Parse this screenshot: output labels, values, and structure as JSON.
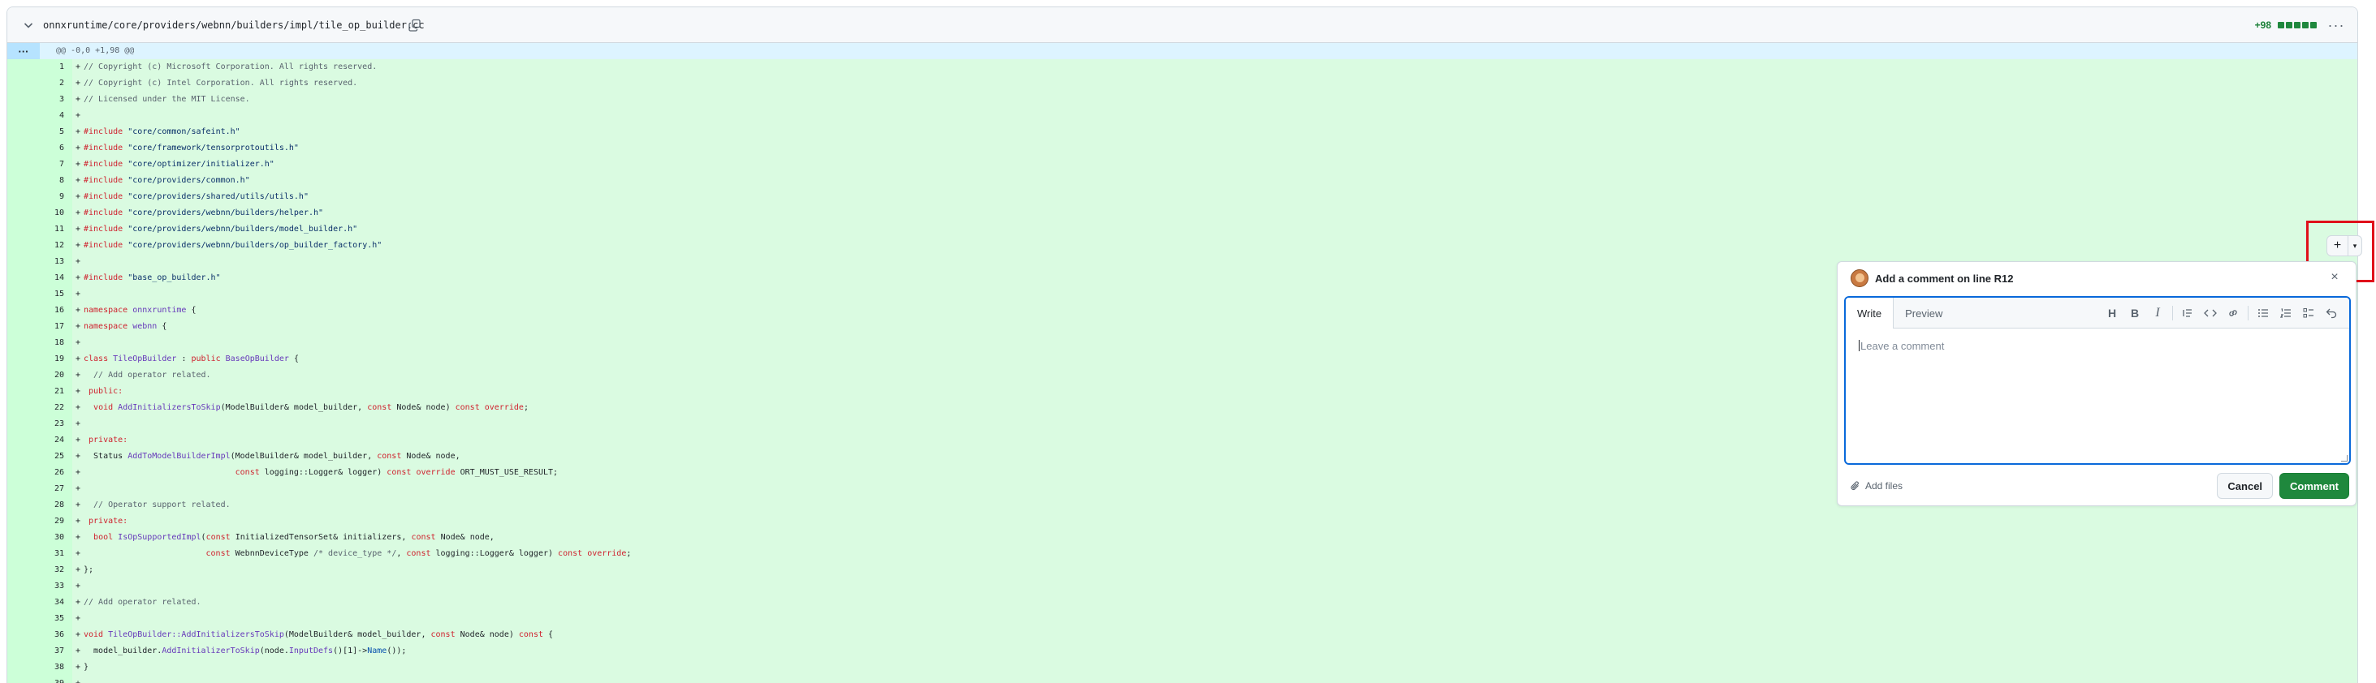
{
  "file": {
    "path": "onnxruntime/core/providers/webnn/builders/impl/tile_op_builder.cc",
    "additions": "+98",
    "diff_blocks": 5,
    "hunk_header": "@@ -0,0 +1,98 @@",
    "expand_label": "···",
    "menu_label": "···",
    "icons": [
      "chevron-down-icon",
      "copy-icon",
      "kebab-horizontal-icon"
    ]
  },
  "diff": {
    "lines": [
      {
        "n": "1",
        "s": "+",
        "t": [
          [
            "cm",
            "// Copyright (c) Microsoft Corporation. All rights reserved."
          ]
        ]
      },
      {
        "n": "2",
        "s": "+",
        "t": [
          [
            "cm",
            "// Copyright (c) Intel Corporation. All rights reserved."
          ]
        ]
      },
      {
        "n": "3",
        "s": "+",
        "t": [
          [
            "cm",
            "// Licensed under the MIT License."
          ]
        ]
      },
      {
        "n": "4",
        "s": "+",
        "t": []
      },
      {
        "n": "5",
        "s": "+",
        "t": [
          [
            "kw",
            "#include"
          ],
          [
            "",
            " "
          ],
          [
            "str",
            "\"core/common/safeint.h\""
          ]
        ]
      },
      {
        "n": "6",
        "s": "+",
        "t": [
          [
            "kw",
            "#include"
          ],
          [
            "",
            " "
          ],
          [
            "str",
            "\"core/framework/tensorprotoutils.h\""
          ]
        ]
      },
      {
        "n": "7",
        "s": "+",
        "t": [
          [
            "kw",
            "#include"
          ],
          [
            "",
            " "
          ],
          [
            "str",
            "\"core/optimizer/initializer.h\""
          ]
        ]
      },
      {
        "n": "8",
        "s": "+",
        "t": [
          [
            "kw",
            "#include"
          ],
          [
            "",
            " "
          ],
          [
            "str",
            "\"core/providers/common.h\""
          ]
        ]
      },
      {
        "n": "9",
        "s": "+",
        "t": [
          [
            "kw",
            "#include"
          ],
          [
            "",
            " "
          ],
          [
            "str",
            "\"core/providers/shared/utils/utils.h\""
          ]
        ]
      },
      {
        "n": "10",
        "s": "+",
        "t": [
          [
            "kw",
            "#include"
          ],
          [
            "",
            " "
          ],
          [
            "str",
            "\"core/providers/webnn/builders/helper.h\""
          ]
        ]
      },
      {
        "n": "11",
        "s": "+",
        "t": [
          [
            "kw",
            "#include"
          ],
          [
            "",
            " "
          ],
          [
            "str",
            "\"core/providers/webnn/builders/model_builder.h\""
          ]
        ]
      },
      {
        "n": "12",
        "s": "+",
        "t": [
          [
            "kw",
            "#include"
          ],
          [
            "",
            " "
          ],
          [
            "str",
            "\"core/providers/webnn/builders/op_builder_factory.h\""
          ]
        ]
      },
      {
        "n": "13",
        "s": "+",
        "t": []
      },
      {
        "n": "14",
        "s": "+",
        "t": [
          [
            "kw",
            "#include"
          ],
          [
            "",
            " "
          ],
          [
            "str",
            "\"base_op_builder.h\""
          ]
        ]
      },
      {
        "n": "15",
        "s": "+",
        "t": []
      },
      {
        "n": "16",
        "s": "+",
        "t": [
          [
            "kw",
            "namespace"
          ],
          [
            "",
            " "
          ],
          [
            "fn",
            "onnxruntime"
          ],
          [
            "",
            " {"
          ]
        ]
      },
      {
        "n": "17",
        "s": "+",
        "t": [
          [
            "kw",
            "namespace"
          ],
          [
            "",
            " "
          ],
          [
            "fn",
            "webnn"
          ],
          [
            "",
            " {"
          ]
        ]
      },
      {
        "n": "18",
        "s": "+",
        "t": []
      },
      {
        "n": "19",
        "s": "+",
        "t": [
          [
            "kw",
            "class"
          ],
          [
            "",
            " "
          ],
          [
            "fn",
            "TileOpBuilder"
          ],
          [
            "",
            " : "
          ],
          [
            "kw",
            "public"
          ],
          [
            "",
            " "
          ],
          [
            "fn",
            "BaseOpBuilder"
          ],
          [
            "",
            " {"
          ]
        ]
      },
      {
        "n": "20",
        "s": "+",
        "t": [
          [
            "cm",
            "  // Add operator related."
          ]
        ]
      },
      {
        "n": "21",
        "s": "+",
        "t": [
          [
            "kw",
            " public:"
          ]
        ]
      },
      {
        "n": "22",
        "s": "+",
        "t": [
          [
            "",
            "  "
          ],
          [
            "kw",
            "void"
          ],
          [
            "",
            " "
          ],
          [
            "fn",
            "AddInitializersToSkip"
          ],
          [
            "",
            "(ModelBuilder& model_builder, "
          ],
          [
            "kw",
            "const"
          ],
          [
            "",
            " Node& node) "
          ],
          [
            "kw",
            "const"
          ],
          [
            "",
            " "
          ],
          [
            "kw",
            "override"
          ],
          [
            "",
            ";"
          ]
        ]
      },
      {
        "n": "23",
        "s": "+",
        "t": []
      },
      {
        "n": "24",
        "s": "+",
        "t": [
          [
            "kw",
            " private:"
          ]
        ]
      },
      {
        "n": "25",
        "s": "+",
        "t": [
          [
            "",
            "  Status "
          ],
          [
            "fn",
            "AddToModelBuilderImpl"
          ],
          [
            "",
            "(ModelBuilder& model_builder, "
          ],
          [
            "kw",
            "const"
          ],
          [
            "",
            " Node& node,"
          ]
        ]
      },
      {
        "n": "26",
        "s": "+",
        "t": [
          [
            "",
            "                               "
          ],
          [
            "kw",
            "const"
          ],
          [
            "",
            " logging::Logger& logger) "
          ],
          [
            "kw",
            "const"
          ],
          [
            "",
            " "
          ],
          [
            "kw",
            "override"
          ],
          [
            "",
            " ORT_MUST_USE_RESULT;"
          ]
        ]
      },
      {
        "n": "27",
        "s": "+",
        "t": []
      },
      {
        "n": "28",
        "s": "+",
        "t": [
          [
            "cm",
            "  // Operator support related."
          ]
        ]
      },
      {
        "n": "29",
        "s": "+",
        "t": [
          [
            "kw",
            " private:"
          ]
        ]
      },
      {
        "n": "30",
        "s": "+",
        "t": [
          [
            "",
            "  "
          ],
          [
            "kw",
            "bool"
          ],
          [
            "",
            " "
          ],
          [
            "fn",
            "IsOpSupportedImpl"
          ],
          [
            "",
            "("
          ],
          [
            "kw",
            "const"
          ],
          [
            "",
            " InitializedTensorSet& initializers, "
          ],
          [
            "kw",
            "const"
          ],
          [
            "",
            " Node& node,"
          ]
        ]
      },
      {
        "n": "31",
        "s": "+",
        "t": [
          [
            "",
            "                         "
          ],
          [
            "kw",
            "const"
          ],
          [
            "",
            " WebnnDeviceType "
          ],
          [
            "cm",
            "/* device_type */"
          ],
          [
            "",
            ", "
          ],
          [
            "kw",
            "const"
          ],
          [
            "",
            " logging::Logger& logger) "
          ],
          [
            "kw",
            "const"
          ],
          [
            "",
            " "
          ],
          [
            "kw",
            "override"
          ],
          [
            "",
            ";"
          ]
        ]
      },
      {
        "n": "32",
        "s": "+",
        "t": [
          [
            "",
            "};"
          ]
        ]
      },
      {
        "n": "33",
        "s": "+",
        "t": []
      },
      {
        "n": "34",
        "s": "+",
        "t": [
          [
            "cm",
            "// Add operator related."
          ]
        ]
      },
      {
        "n": "35",
        "s": "+",
        "t": []
      },
      {
        "n": "36",
        "s": "+",
        "t": [
          [
            "kw",
            "void"
          ],
          [
            "",
            " "
          ],
          [
            "fn",
            "TileOpBuilder::AddInitializersToSkip"
          ],
          [
            "",
            "(ModelBuilder& model_builder, "
          ],
          [
            "kw",
            "const"
          ],
          [
            "",
            " Node& node) "
          ],
          [
            "kw",
            "const"
          ],
          [
            "",
            " {"
          ]
        ]
      },
      {
        "n": "37",
        "s": "+",
        "t": [
          [
            "",
            "  model_builder."
          ],
          [
            "fn",
            "AddInitializerToSkip"
          ],
          [
            "",
            "(node."
          ],
          [
            "fn",
            "InputDefs"
          ],
          [
            "",
            "()[1]->"
          ],
          [
            "cst",
            "Name"
          ],
          [
            "",
            "());"
          ]
        ]
      },
      {
        "n": "38",
        "s": "+",
        "t": [
          [
            "",
            "}"
          ]
        ]
      },
      {
        "n": "39",
        "s": "+",
        "t": []
      }
    ]
  },
  "comment": {
    "title": "Add a comment on line R12",
    "close_label": "×",
    "tabs": [
      "Write",
      "Preview"
    ],
    "placeholder": "Leave a comment",
    "attach_label": "Add files",
    "cancel_label": "Cancel",
    "submit_label": "Comment",
    "toolbar": [
      "heading-icon",
      "bold-icon",
      "italic-icon",
      "quote-icon",
      "code-icon",
      "link-icon",
      "unordered-list-icon",
      "ordered-list-icon",
      "task-list-icon",
      "reply-icon"
    ]
  },
  "add_button": {
    "plus_label": "+",
    "dropdown_label": "▾"
  },
  "colors": {
    "addition_bg": "#dafbe1",
    "addition_gutter": "#ccffd8",
    "hunk_bg": "#ddf4ff",
    "primary_button": "#1f883d",
    "focus_border": "#0969da",
    "highlight_box": "#e0101a"
  }
}
